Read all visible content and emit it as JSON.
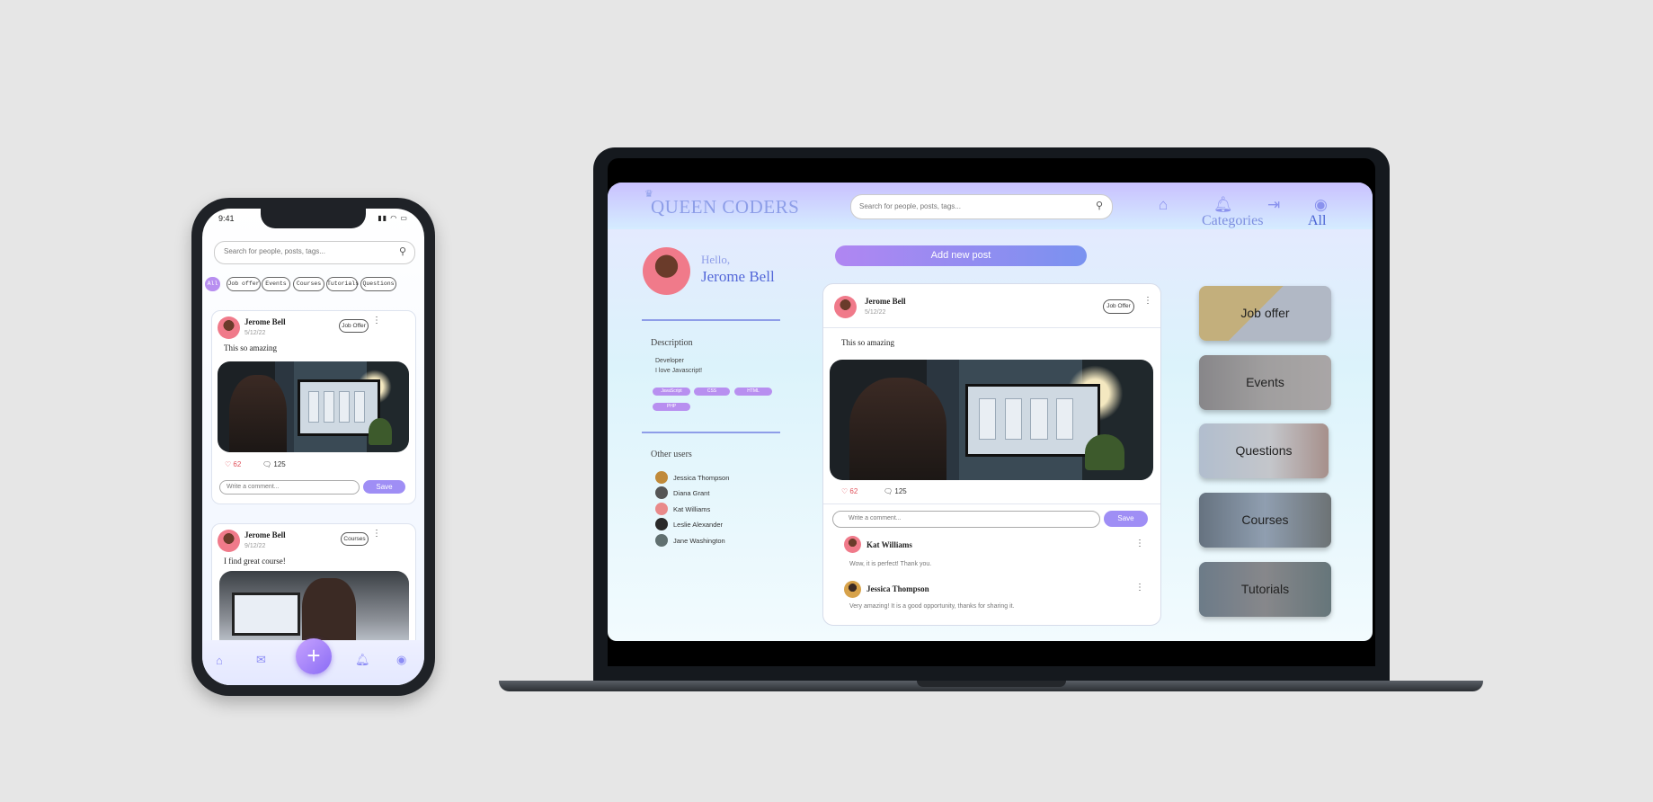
{
  "phone": {
    "status_time": "9:41",
    "search_placeholder": "Search for people, posts, tags...",
    "filters": [
      "All",
      "Job offer",
      "Events",
      "Courses",
      "Tutorials",
      "Questions"
    ],
    "posts": [
      {
        "author": "Jerome Bell",
        "date": "5/12/22",
        "tag": "Job Offer",
        "text": "This so amazing",
        "likes": "62",
        "comments": "125",
        "comment_placeholder": "Write a comment...",
        "save_label": "Save"
      },
      {
        "author": "Jerome Bell",
        "date": "9/12/22",
        "tag": "Courses",
        "text": "I find great course!"
      }
    ]
  },
  "laptop": {
    "logo": "QUEEN CODERS",
    "search_placeholder": "Search for people, posts, tags...",
    "greeting": "Hello,",
    "user_name": "Jerome Bell",
    "description_title": "Description",
    "description_lines": [
      "Developer",
      "I love Javascript!"
    ],
    "skills": [
      "JavaScript",
      "CSS",
      "HTML",
      "PHP"
    ],
    "other_users_title": "Other users",
    "other_users": [
      "Jessica Thompson",
      "Diana Grant",
      "Kat Williams",
      "Leslie Alexander",
      "Jane Washington"
    ],
    "add_post_label": "Add new post",
    "post": {
      "author": "Jerome Bell",
      "date": "5/12/22",
      "tag": "Job Offer",
      "text": "This so amazing",
      "likes": "62",
      "comments": "125",
      "comment_placeholder": "Write a comment...",
      "save_label": "Save",
      "replies": [
        {
          "author": "Kat Williams",
          "text": "Wow, it is perfect! Thank you."
        },
        {
          "author": "Jessica Thompson",
          "text": "Very amazing! It is a good opportunity, thanks for sharing it."
        }
      ]
    },
    "categories_title": "Categories",
    "categories_all": "All",
    "categories": [
      "Job offer",
      "Events",
      "Questions",
      "Courses",
      "Tutorials"
    ]
  },
  "colors": {
    "accent": "#9f8ef5",
    "brand": "#8d9ee8",
    "like": "#e0505a"
  }
}
